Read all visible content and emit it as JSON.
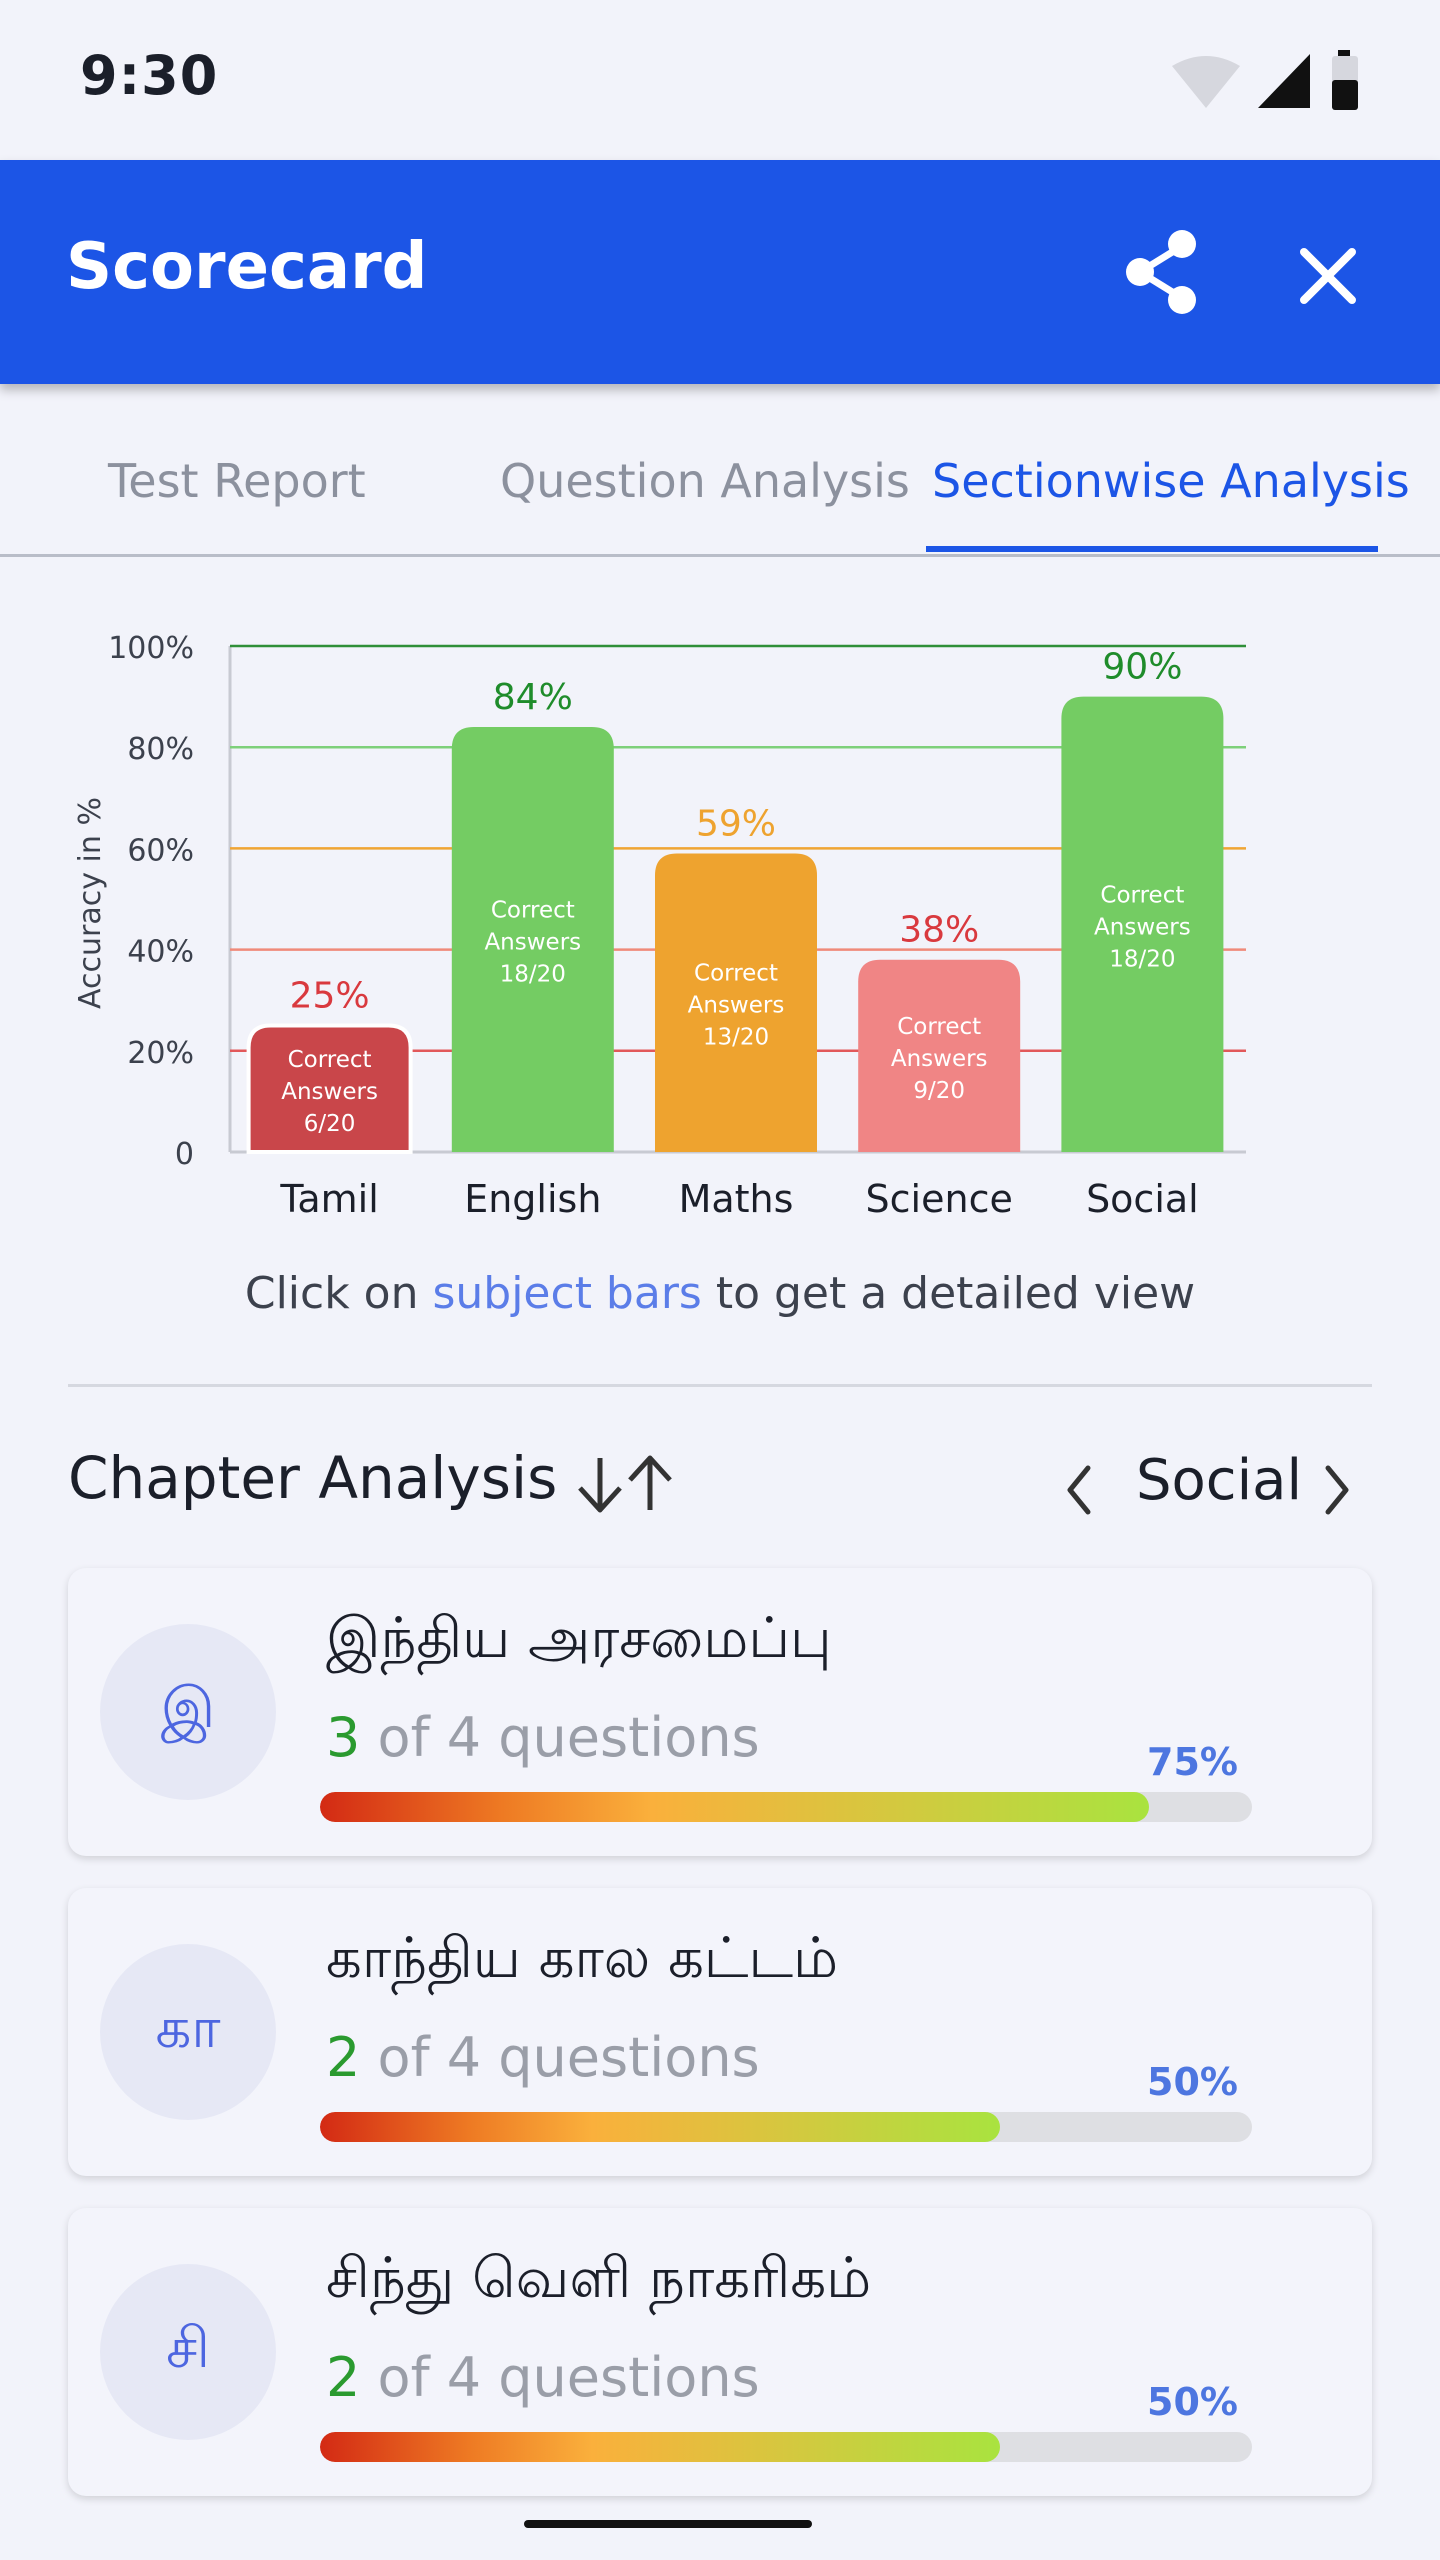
{
  "status_bar": {
    "time": "9:30"
  },
  "app_bar": {
    "title": "Scorecard",
    "share_icon": "share-icon",
    "close_icon": "close-icon"
  },
  "tabs": [
    {
      "label": "Test Report",
      "active": false
    },
    {
      "label": "Question Analysis",
      "active": false
    },
    {
      "label": "Sectionwise Analysis",
      "active": true
    }
  ],
  "chart_data": {
    "type": "bar",
    "title": "",
    "xlabel": "",
    "ylabel": "Accuracy in %",
    "ylim": [
      0,
      100
    ],
    "yticks": [
      "0",
      "20%",
      "40%",
      "60%",
      "80%",
      "100%"
    ],
    "categories": [
      "Tamil",
      "English",
      "Maths",
      "Science",
      "Social"
    ],
    "values": [
      25,
      84,
      59,
      38,
      90
    ],
    "value_labels": [
      "25%",
      "84%",
      "59%",
      "38%",
      "90%"
    ],
    "bar_texts": [
      [
        "Correct",
        "Answers",
        "6/20"
      ],
      [
        "Correct",
        "Answers",
        "18/20"
      ],
      [
        "Correct",
        "Answers",
        "13/20"
      ],
      [
        "Correct",
        "Answers",
        "9/20"
      ],
      [
        "Correct",
        "Answers",
        "18/20"
      ]
    ],
    "bar_colors": [
      "#c9464a",
      "#74cc63",
      "#eea32f",
      "#f08585",
      "#74cc63"
    ],
    "label_colors": [
      "#d9393e",
      "#1f8c2b",
      "#eea32f",
      "#d9393e",
      "#1f8c2b"
    ],
    "threshold_lines": [
      {
        "value": 100,
        "color": "#2f8f38"
      },
      {
        "value": 80,
        "color": "#7ed07a"
      },
      {
        "value": 60,
        "color": "#f0a533"
      },
      {
        "value": 40,
        "color": "#f08a7a"
      },
      {
        "value": 20,
        "color": "#e2585a"
      }
    ],
    "selected_category": "Tamil",
    "grid": false
  },
  "hint": {
    "prefix": "Click on ",
    "link": "subject bars",
    "suffix": " to get a detailed view"
  },
  "chapter_analysis": {
    "title": "Chapter Analysis",
    "subject": "Social",
    "chapters": [
      {
        "initial": "இ",
        "name": "இந்திய அரசமைப்பு",
        "correct": "3",
        "rest": " of 4 questions",
        "percent_label": "75%",
        "fraction": 0.89
      },
      {
        "initial": "கா",
        "name": "காந்திய கால கட்டம்",
        "correct": "2",
        "rest": " of 4 questions",
        "percent_label": "50%",
        "fraction": 0.73
      },
      {
        "initial": "சி",
        "name": "சிந்து வெளி நாகரிகம்",
        "correct": "2",
        "rest": " of 4 questions",
        "percent_label": "50%",
        "fraction": 0.73
      }
    ]
  }
}
